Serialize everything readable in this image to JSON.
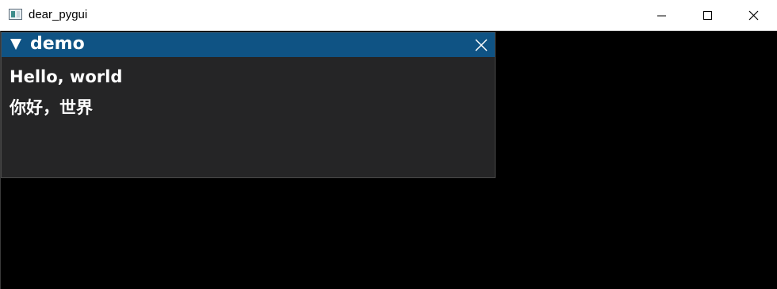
{
  "window": {
    "title": "dear_pygui"
  },
  "demo_window": {
    "title": "demo",
    "lines": [
      "Hello, world",
      "你好，世界"
    ]
  },
  "colors": {
    "title_bar": "#0f5384",
    "window_bg": "#252526",
    "viewport_bg": "#000000"
  },
  "icons": {
    "app": "app-icon",
    "minimize": "minimize-icon",
    "maximize": "maximize-icon",
    "close": "close-icon",
    "collapse": "triangle-down-icon",
    "window_close": "close-icon"
  }
}
